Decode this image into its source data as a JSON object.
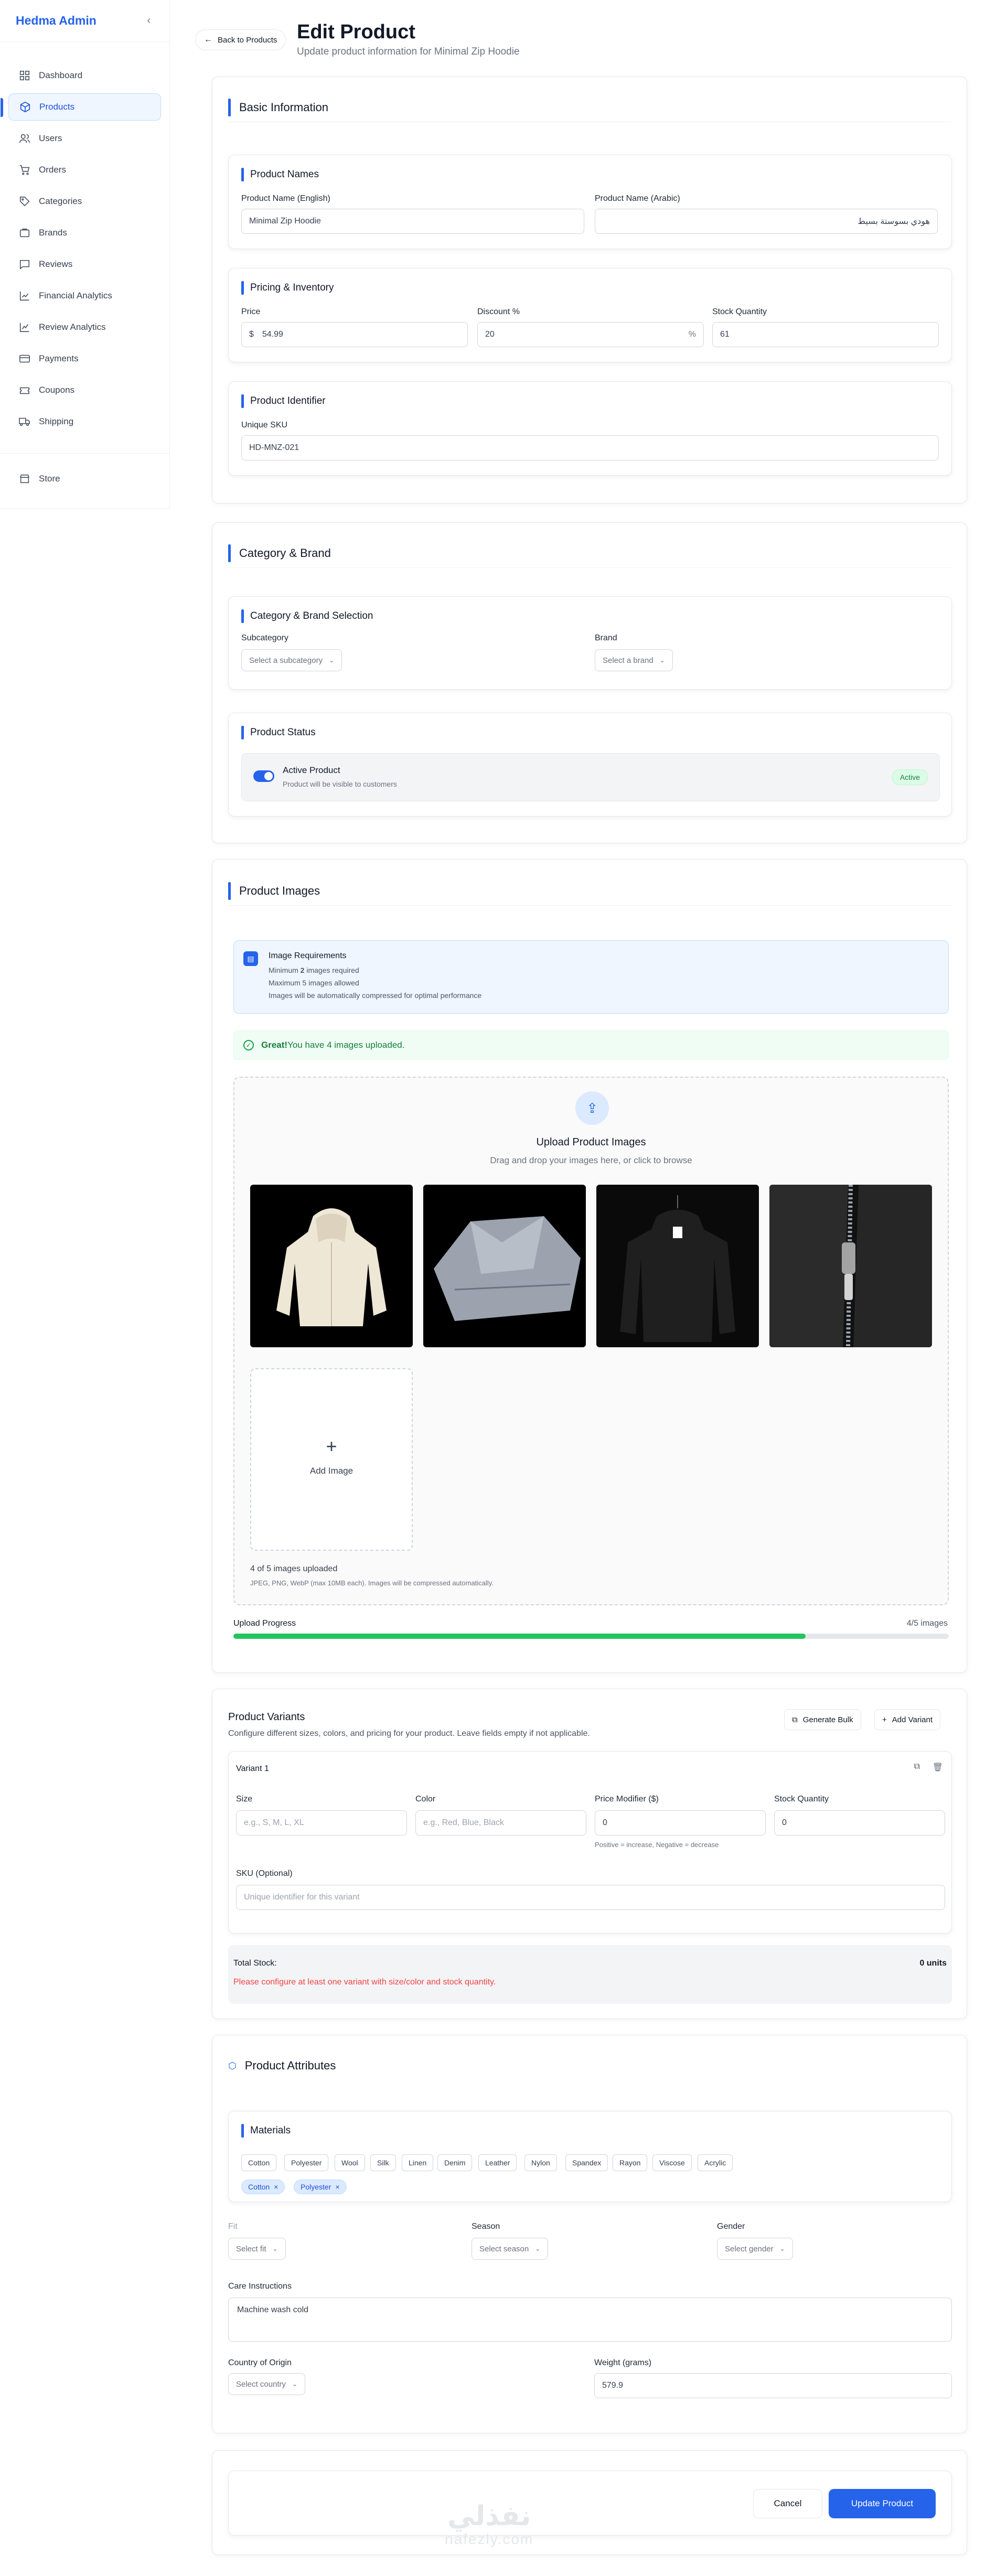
{
  "sidebar": {
    "brand": "Hedma Admin",
    "collapse_icon": "‹",
    "items": [
      {
        "label": "Dashboard",
        "icon": "dashboard-icon"
      },
      {
        "label": "Products",
        "icon": "box-icon"
      },
      {
        "label": "Users",
        "icon": "users-icon"
      },
      {
        "label": "Orders",
        "icon": "cart-icon"
      },
      {
        "label": "Categories",
        "icon": "tag-icon"
      },
      {
        "label": "Brands",
        "icon": "brand-icon"
      },
      {
        "label": "Reviews",
        "icon": "chat-icon"
      },
      {
        "label": "Financial Analytics",
        "icon": "chart-icon"
      },
      {
        "label": "Review Analytics",
        "icon": "chart-icon"
      },
      {
        "label": "Payments",
        "icon": "card-icon"
      },
      {
        "label": "Coupons",
        "icon": "coupon-icon"
      },
      {
        "label": "Shipping",
        "icon": "truck-icon"
      }
    ],
    "store": "Store"
  },
  "header": {
    "back": "Back to Products",
    "title": "Edit Product",
    "subtitle": "Update product information for Minimal Zip Hoodie"
  },
  "basic": {
    "title": "Basic Information",
    "names_title": "Product Names",
    "name_en_label": "Product Name (English)",
    "name_en_value": "Minimal Zip Hoodie",
    "name_ar_label": "Product Name (Arabic)",
    "name_ar_value": "هودي بسوستة بسيط",
    "pricing_title": "Pricing & Inventory",
    "price_label": "Price",
    "currency": "$",
    "price_value": "54.99",
    "discount_label": "Discount %",
    "discount_value": "20",
    "percent": "%",
    "stock_label": "Stock Quantity",
    "stock_value": "61",
    "identifier_title": "Product Identifier",
    "sku_label": "Unique SKU",
    "sku_value": "HD-MNZ-021"
  },
  "category": {
    "title": "Category & Brand",
    "selection_title": "Category & Brand Selection",
    "subcategory_label": "Subcategory",
    "subcategory_placeholder": "Select a subcategory",
    "brand_label": "Brand",
    "brand_placeholder": "Select a brand",
    "status_title": "Product Status",
    "active_title": "Active Product",
    "active_desc": "Product will be visible to customers",
    "active_badge": "Active"
  },
  "images": {
    "title": "Product Images",
    "req_title": "Image Requirements",
    "req_min_pre": "Minimum ",
    "req_min_num": "2",
    "req_min_post": " images required",
    "req_max": "Maximum 5 images allowed",
    "req_compress": "Images will be automatically compressed for optimal performance",
    "success_bold": "Great!",
    "success_text": " You have 4 images uploaded.",
    "upload_title": "Upload Product Images",
    "upload_sub": "Drag and drop your images here, or click to browse",
    "add_image": "Add Image",
    "count_text": "4 of 5 images uploaded",
    "formats": "JPEG, PNG, WebP (max 10MB each). Images will be compressed automatically.",
    "progress_label": "Upload Progress",
    "progress_count": "4/5 images",
    "progress_fraction": 0.8
  },
  "variants": {
    "title": "Product Variants",
    "subtitle": "Configure different sizes, colors, and pricing for your product. Leave fields empty if not applicable.",
    "generate": "Generate Bulk",
    "add": "Add Variant",
    "variant_title": "Variant 1",
    "size_label": "Size",
    "size_placeholder": "e.g., S, M, L, XL",
    "color_label": "Color",
    "color_placeholder": "e.g., Red, Blue, Black",
    "price_mod_label": "Price Modifier ($)",
    "price_mod_value": "0",
    "price_hint": "Positive = increase, Negative = decrease",
    "qty_label": "Stock Quantity",
    "qty_value": "0",
    "sku_label": "SKU (Optional)",
    "sku_placeholder": "Unique identifier for this variant",
    "total_label": "Total Stock:",
    "total_value": "0 units",
    "warning": "Please configure at least one variant with size/color and stock quantity."
  },
  "attributes": {
    "title": "Product Attributes",
    "materials_title": "Materials",
    "materials": [
      "Cotton",
      "Polyester",
      "Wool",
      "Silk",
      "Linen",
      "Denim",
      "Leather",
      "Nylon",
      "Spandex",
      "Rayon",
      "Viscose",
      "Acrylic"
    ],
    "selected": [
      "Cotton",
      "Polyester"
    ],
    "remove": "×",
    "fit_label": "Fit",
    "fit_placeholder": "Select fit",
    "season_label": "Season",
    "season_placeholder": "Select season",
    "gender_label": "Gender",
    "gender_placeholder": "Select gender",
    "care_label": "Care Instructions",
    "care_value": "Machine wash cold",
    "country_label": "Country of Origin",
    "country_placeholder": "Select country",
    "weight_label": "Weight (grams)",
    "weight_value": "579.9"
  },
  "footer": {
    "cancel": "Cancel",
    "update": "Update Product"
  },
  "watermark": {
    "arabic": "نفذلي",
    "latin": "nafezly.com"
  },
  "colors": {
    "primary": "#2563eb",
    "success": "#22c55e",
    "danger": "#ef4444"
  }
}
